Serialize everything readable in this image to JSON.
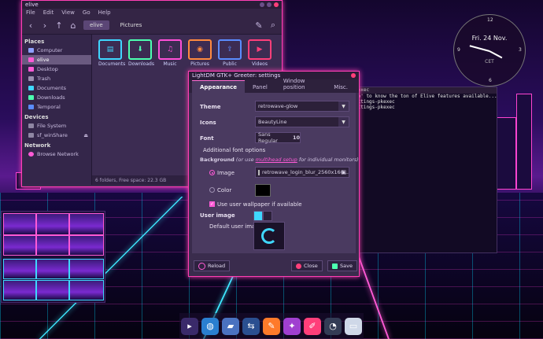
{
  "file_manager": {
    "title": "elive",
    "menu": [
      "File",
      "Edit",
      "View",
      "Go",
      "Help"
    ],
    "path": [
      "elive",
      "Pictures"
    ],
    "sidebar": {
      "sections": [
        {
          "header": "Places",
          "items": [
            "Computer",
            "elive",
            "Desktop",
            "Trash",
            "Documents",
            "Downloads",
            "Temporal"
          ]
        },
        {
          "header": "Devices",
          "items": [
            "File System",
            "sf_winShare"
          ]
        },
        {
          "header": "Network",
          "items": [
            "Browse Network"
          ]
        }
      ],
      "selected": "elive"
    },
    "folders": [
      {
        "label": "Documents",
        "icon": "document-folder-icon",
        "color": "#3fd7ff",
        "glyph": "▤"
      },
      {
        "label": "Downloads",
        "icon": "download-folder-icon",
        "color": "#4cffb0",
        "glyph": "⬇"
      },
      {
        "label": "Music",
        "icon": "music-folder-icon",
        "color": "#ff4fd8",
        "glyph": "♫"
      },
      {
        "label": "Pictures",
        "icon": "pictures-folder-icon",
        "color": "#ff8a3f",
        "glyph": "◉"
      },
      {
        "label": "Public",
        "icon": "public-folder-icon",
        "color": "#5a8cff",
        "glyph": "⇪"
      },
      {
        "label": "Videos",
        "icon": "videos-folder-icon",
        "color": "#ff3f7a",
        "glyph": "▶"
      }
    ],
    "status": "6 folders, Free space: 22.3 GB"
  },
  "terminal": {
    "title": "kexec",
    "lines": [
      "lp' to know the ton of Elive features available...",
      "ettings-pkexec",
      "ettings-pkexec"
    ]
  },
  "clock": {
    "date": "Fri. 24 Nov.",
    "timezone": "CET",
    "numbers": [
      "12",
      "3",
      "6",
      "9"
    ]
  },
  "dialog": {
    "title": "LightDM GTK+ Greeter: settings",
    "tabs": [
      "Appearance",
      "Panel",
      "Window position",
      "Misc."
    ],
    "active_tab": "Appearance",
    "theme_label": "Theme",
    "theme_value": "retrowave-glow",
    "icons_label": "Icons",
    "icons_value": "BeautyLine",
    "font_label": "Font",
    "font_value": "Sans Regular",
    "font_size": "10",
    "additional_font": "Additional font options",
    "background_label": "Background",
    "background_note_pre": "(or use ",
    "background_note_link": "multihead setup",
    "background_note_post": " for individual monitors)",
    "image_label": "Image",
    "image_file": "retrowave_login_blur_2560x160...",
    "color_label": "Color",
    "use_wallpaper": "Use user wallpaper if available",
    "user_image_label": "User image",
    "default_user_image": "Default user image",
    "reload": "Reload",
    "close": "Close",
    "save": "Save"
  },
  "dock": [
    {
      "name": "terminal-icon",
      "glyph": "▸",
      "color": "#3a2a6a"
    },
    {
      "name": "browser-icon",
      "glyph": "◍",
      "color": "#2a7fd0"
    },
    {
      "name": "file-manager-icon",
      "glyph": "▰",
      "color": "#4a72c0"
    },
    {
      "name": "folder-sharing-icon",
      "glyph": "⇆",
      "color": "#2a4f90"
    },
    {
      "name": "inkscape-icon",
      "glyph": "✎",
      "color": "#ff7a2a"
    },
    {
      "name": "brush-icon",
      "glyph": "✦",
      "color": "#a03fd0"
    },
    {
      "name": "editor-icon",
      "glyph": "✐",
      "color": "#ff3f7a"
    },
    {
      "name": "clock-app-icon",
      "glyph": "◔",
      "color": "#333c55"
    },
    {
      "name": "screenshot-icon",
      "glyph": "▭",
      "color": "#cfd8e8"
    }
  ]
}
